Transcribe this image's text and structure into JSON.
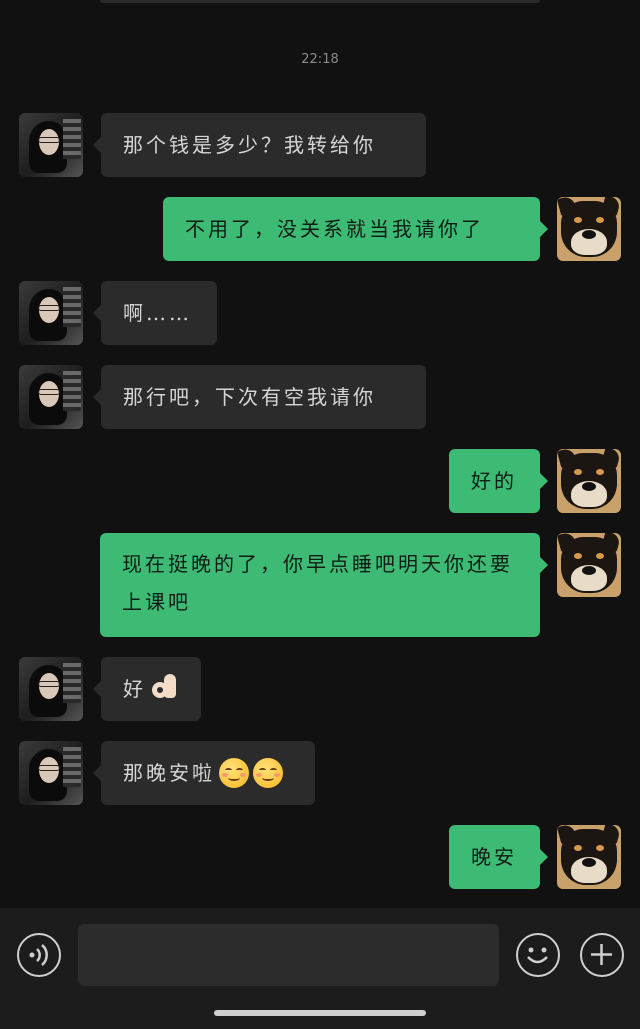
{
  "timestamp": "22:18",
  "messages": [
    {
      "side": "in",
      "text": "那个钱是多少？我转给你"
    },
    {
      "side": "out",
      "text": "不用了，没关系就当我请你了"
    },
    {
      "side": "in",
      "text": "啊……"
    },
    {
      "side": "in",
      "text": "那行吧，下次有空我请你"
    },
    {
      "side": "out",
      "text": "好的"
    },
    {
      "side": "out",
      "text": "现在挺晚的了，你早点睡吧明天你还要上课吧"
    },
    {
      "side": "in",
      "text": "好",
      "emoji": "ok-hand-emoji"
    },
    {
      "side": "in",
      "text": "那晚安啦",
      "emoji": "smiling-face-emoji x2"
    },
    {
      "side": "out",
      "text": "晚安"
    }
  ],
  "input_bar": {
    "voice_icon": "voice-icon",
    "emoji_icon": "emoji-icon",
    "plus_icon": "plus-icon",
    "input_value": ""
  }
}
